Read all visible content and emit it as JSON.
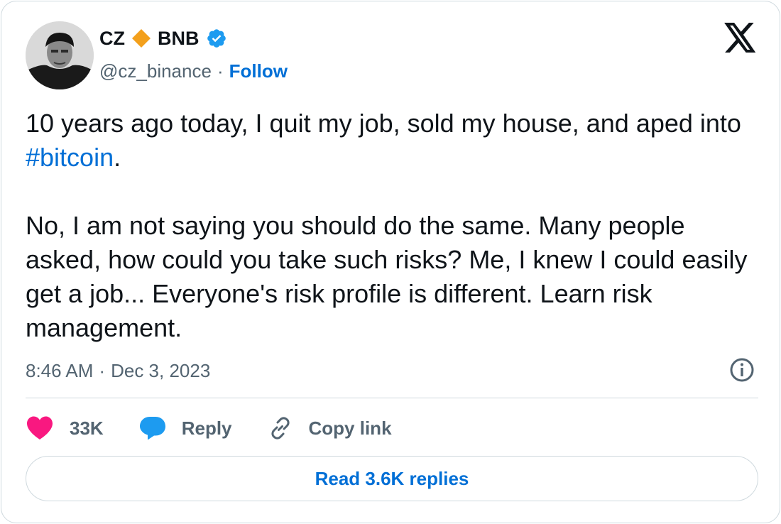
{
  "author": {
    "display_name": "CZ",
    "suffix": "BNB",
    "handle": "@cz_binance",
    "follow_label": "Follow",
    "verified": true,
    "badge_color": "#f3a01c",
    "verified_color": "#1d9bf0"
  },
  "tweet": {
    "line1_pre": "10 years ago today, I quit my job, sold my house, and aped into ",
    "hashtag": "#bitcoin",
    "line1_post": ".",
    "paragraph2": "No, I am not saying you should do the same. Many people asked, how could you take such risks? Me, I knew I could easily get a job... Everyone's risk profile is different. Learn risk management."
  },
  "meta": {
    "time": "8:46 AM",
    "separator": "·",
    "date": "Dec 3, 2023"
  },
  "actions": {
    "likes_count": "33K",
    "reply_label": "Reply",
    "copy_link_label": "Copy link"
  },
  "read_replies_label": "Read 3.6K replies",
  "colors": {
    "link": "#006fd6",
    "like_heart": "#f91880",
    "reply_bubble": "#1d9bf0",
    "secondary_text": "#536471"
  },
  "icons": [
    "x-logo-icon",
    "bnb-diamond-icon",
    "verified-badge-icon",
    "info-icon",
    "heart-icon",
    "reply-bubble-icon",
    "link-icon"
  ]
}
